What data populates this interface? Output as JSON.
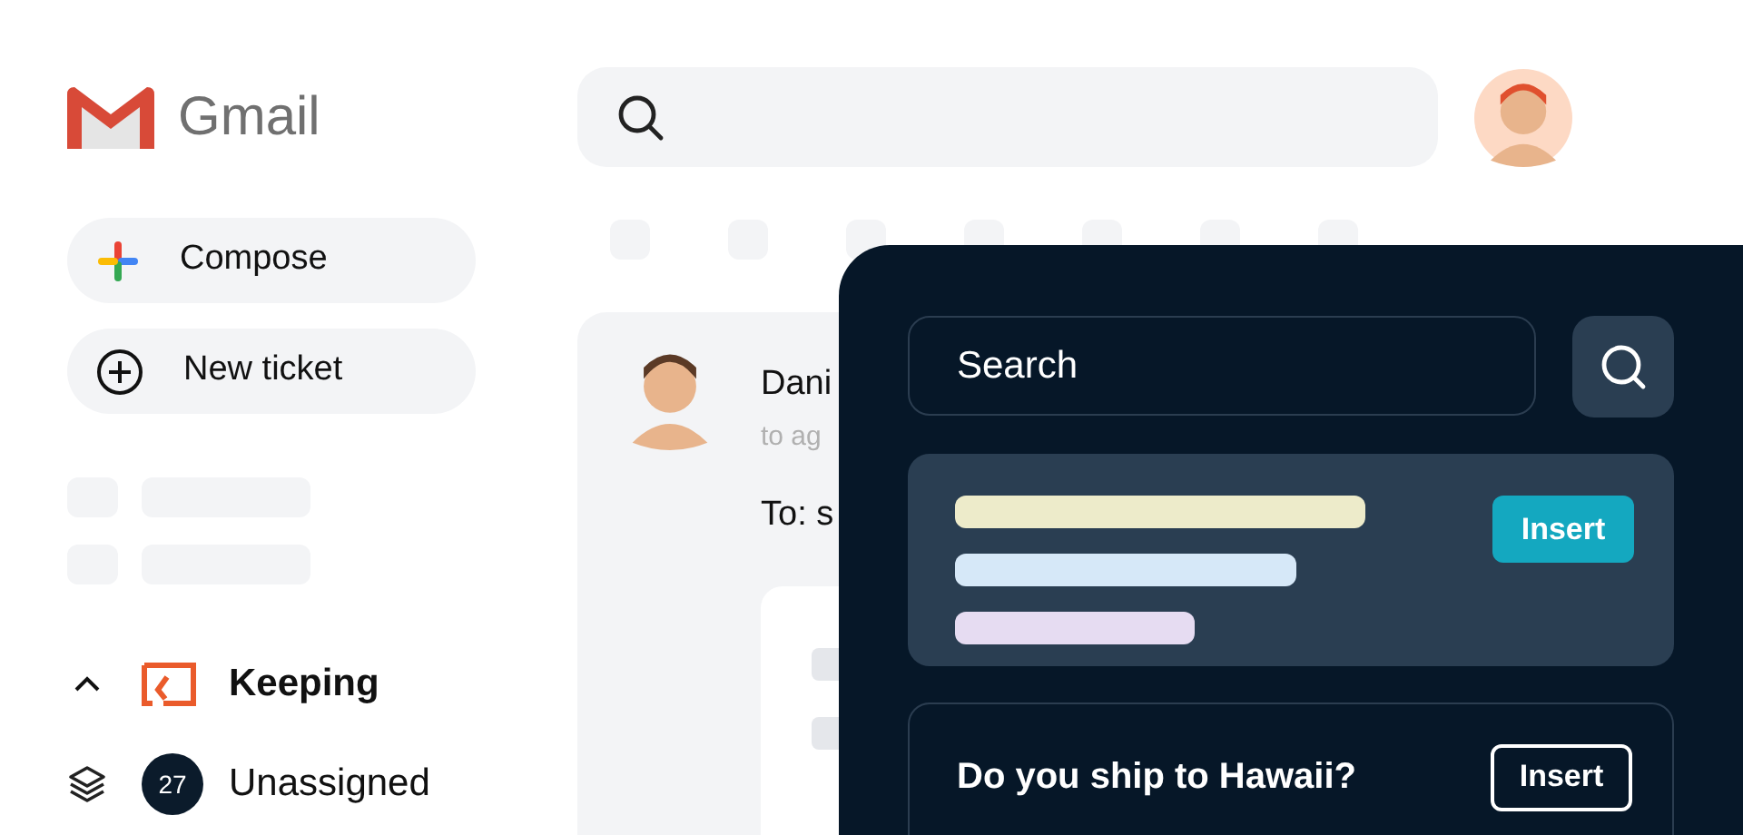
{
  "logo": {
    "text": "Gmail"
  },
  "sidebar": {
    "buttons": [
      {
        "label": "Compose",
        "kind": "compose"
      },
      {
        "label": "New ticket",
        "kind": "new"
      }
    ],
    "section": {
      "title": "Keeping",
      "expanded": true,
      "items": [
        {
          "count": "27",
          "label": "Unassigned"
        }
      ]
    }
  },
  "email": {
    "sender": "Dani",
    "meta": "to ag",
    "to": "To: s"
  },
  "panel": {
    "search": {
      "placeholder": "Search"
    },
    "results": [
      {
        "kind": "skeleton",
        "button": "Insert"
      },
      {
        "kind": "text",
        "title": "Do you ship to Hawaii?",
        "button": "Insert"
      }
    ]
  }
}
